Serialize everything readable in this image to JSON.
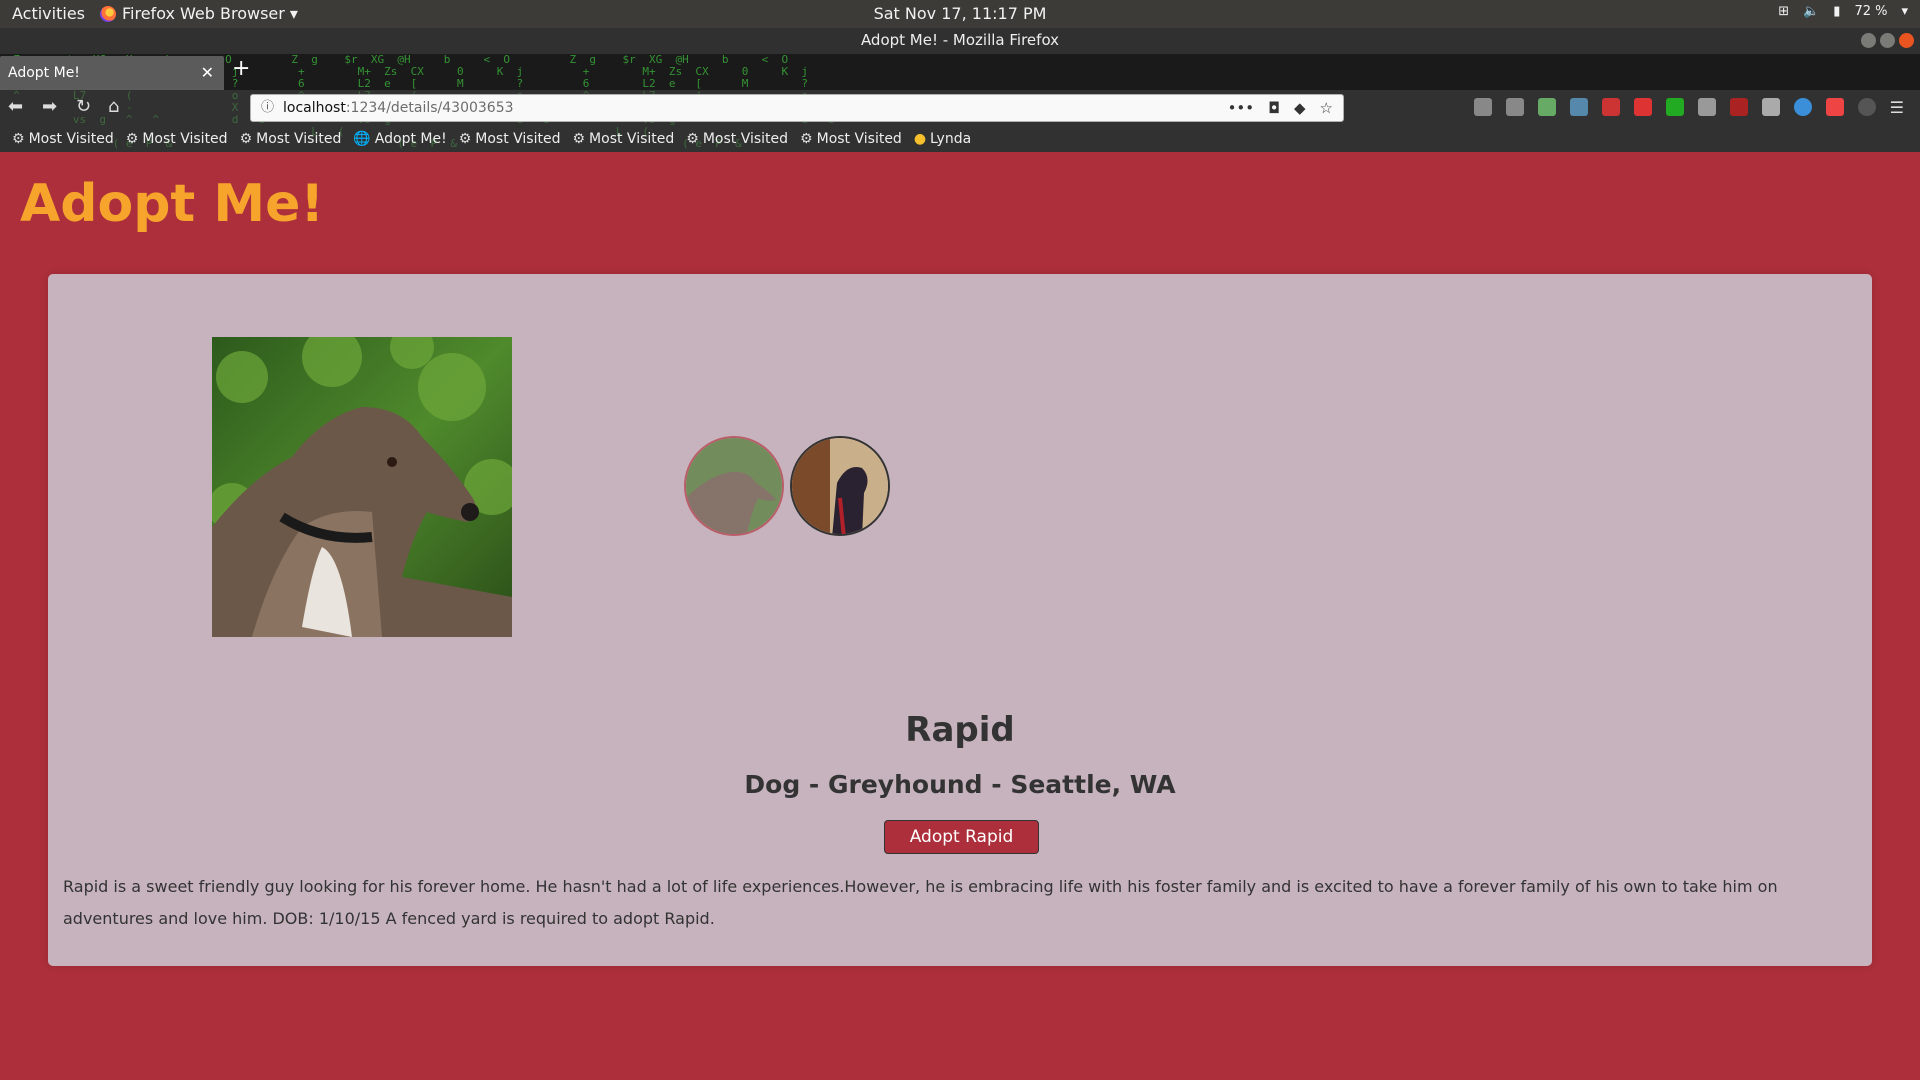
{
  "system": {
    "activities": "Activities",
    "app_menu": "Firefox Web Browser ▾",
    "clock": "Sat Nov 17, 11:17 PM",
    "battery": "72 %"
  },
  "browser": {
    "window_title": "Adopt Me! - Mozilla Firefox",
    "tab_title": "Adopt Me!",
    "url_host": "localhost",
    "url_path": ":1234/details/43003653",
    "bookmarks": [
      {
        "label": "Most Visited",
        "icon": "gear-icon"
      },
      {
        "label": "Most Visited",
        "icon": "gear-icon"
      },
      {
        "label": "Most Visited",
        "icon": "gear-icon"
      },
      {
        "label": "Adopt Me!",
        "icon": "globe-icon"
      },
      {
        "label": "Most Visited",
        "icon": "gear-icon"
      },
      {
        "label": "Most Visited",
        "icon": "gear-icon"
      },
      {
        "label": "Most Visited",
        "icon": "gear-icon"
      },
      {
        "label": "Most Visited",
        "icon": "gear-icon"
      },
      {
        "label": "Lynda",
        "icon": "lynda-icon"
      }
    ]
  },
  "page": {
    "brand": "Adopt Me!",
    "pet": {
      "name": "Rapid",
      "subtitle": "Dog - Greyhound - Seattle, WA",
      "adopt_label": "Adopt Rapid",
      "description": "Rapid is a sweet friendly guy looking for his forever home. He hasn't had a lot of life experiences.However, he is embracing life with his foster family and is excited to have a forever family of his own to take him on adventures and love him. DOB: 1/10/15 A fenced yard is required to adopt Rapid."
    },
    "colors": {
      "background": "#ad2f3b",
      "brand": "#f6a42c",
      "card": "#c6b3bd"
    }
  }
}
